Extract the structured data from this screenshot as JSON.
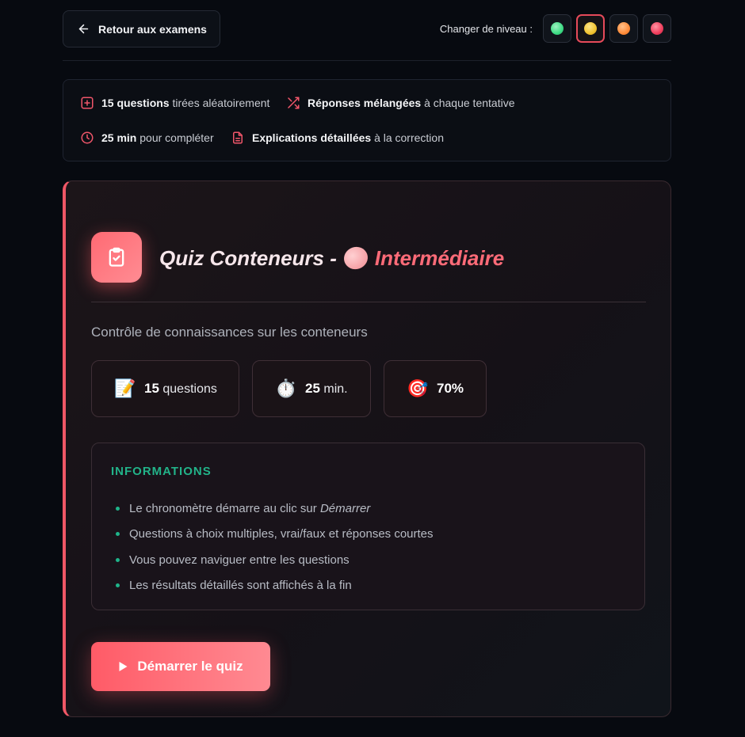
{
  "header": {
    "back_label": "Retour aux examens",
    "level_label": "Changer de niveau :",
    "levels": [
      {
        "name": "green",
        "color": "#3ddc84"
      },
      {
        "name": "yellow",
        "color": "#f2c230",
        "active": true
      },
      {
        "name": "orange",
        "color": "#ff8c3a"
      },
      {
        "name": "red",
        "color": "#ef3e5c"
      }
    ]
  },
  "features": {
    "questions": {
      "strong": "15 questions",
      "rest": "tirées aléatoirement"
    },
    "shuffle": {
      "strong": "Réponses mélangées",
      "rest": "à chaque tentative"
    },
    "time": {
      "strong": "25 min",
      "rest": "pour compléter"
    },
    "explanations": {
      "strong": "Explications détaillées",
      "rest": "à la correction"
    }
  },
  "quiz": {
    "title": "Quiz Conteneurs -",
    "level": "Intermédiaire",
    "subtitle": "Contrôle de connaissances sur les conteneurs",
    "stats": [
      {
        "emoji": "📝",
        "value": "15",
        "unit": "questions"
      },
      {
        "emoji": "⏱️",
        "value": "25",
        "unit": "min."
      },
      {
        "emoji": "🎯",
        "value": "70%",
        "unit": ""
      }
    ],
    "info": {
      "title": "INFORMATIONS",
      "items": [
        {
          "text": "Le chronomètre démarre au clic sur",
          "emphasis": "Démarrer"
        },
        {
          "text": "Questions à choix multiples, vrai/faux et réponses courtes"
        },
        {
          "text": "Vous pouvez naviguer entre les questions"
        },
        {
          "text": "Les résultats détaillés sont affichés à la fin"
        }
      ]
    },
    "start_label": "Démarrer le quiz"
  },
  "colors": {
    "accent": "#ff5b67",
    "info_green": "#22b389",
    "background": "#070a10"
  }
}
